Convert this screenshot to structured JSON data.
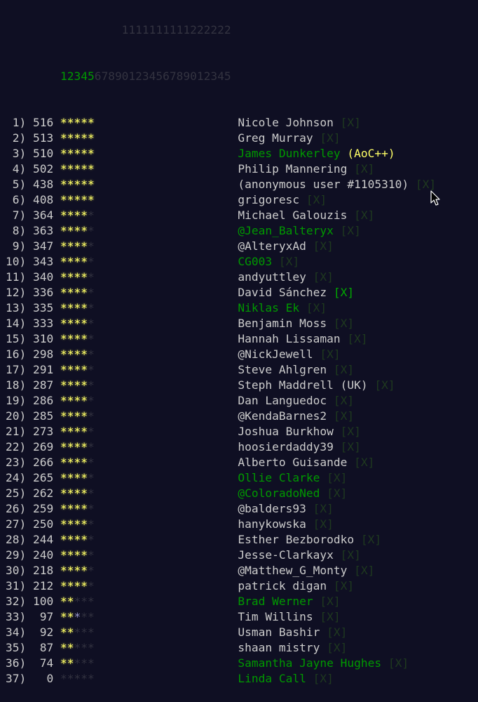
{
  "header": {
    "tens_row": "         1111111111222222",
    "units_row": "1234567890123456789012345",
    "days_completed_highlight": 5
  },
  "colors": {
    "background": "#0f0f23",
    "text": "#cccccc",
    "gold_star": "#ffff66",
    "silver_star": "#9999cc",
    "unearned_star": "#333340",
    "link_green": "#009900",
    "remove_dim": "#1f3a1f",
    "remove_hover": "#00aa00"
  },
  "remove_label": "[X]",
  "aocpp_label": "(AoC++)",
  "rows": [
    {
      "rank": "1)",
      "score": "516",
      "stars": "GGGGG",
      "name": "Nicole Johnson",
      "link": false
    },
    {
      "rank": "2)",
      "score": "513",
      "stars": "GGGGG",
      "name": "Greg Murray",
      "link": false
    },
    {
      "rank": "3)",
      "score": "510",
      "stars": "GGGGG",
      "name": "James Dunkerley",
      "link": true,
      "aocpp": true,
      "no_remove": true
    },
    {
      "rank": "4)",
      "score": "502",
      "stars": "GGGGG",
      "name": "Philip Mannering",
      "link": false
    },
    {
      "rank": "5)",
      "score": "438",
      "stars": "GGGGG",
      "name": "(anonymous user #1105310)",
      "link": false
    },
    {
      "rank": "6)",
      "score": "408",
      "stars": "GGGGG",
      "name": "grigoresc",
      "link": false
    },
    {
      "rank": "7)",
      "score": "364",
      "stars": "GGGG.",
      "name": "Michael Galouzis",
      "link": false
    },
    {
      "rank": "8)",
      "score": "363",
      "stars": "GGGG.",
      "name": "@Jean_Balteryx",
      "link": true
    },
    {
      "rank": "9)",
      "score": "347",
      "stars": "GGGG.",
      "name": "@AlteryxAd",
      "link": false
    },
    {
      "rank": "10)",
      "score": "343",
      "stars": "GGGG.",
      "name": "CG003",
      "link": true
    },
    {
      "rank": "11)",
      "score": "340",
      "stars": "GGGG.",
      "name": "andyuttley",
      "link": false
    },
    {
      "rank": "12)",
      "score": "336",
      "stars": "GGGG.",
      "name": "David Sánchez",
      "link": false,
      "remove_hover": true
    },
    {
      "rank": "13)",
      "score": "335",
      "stars": "GGGG.",
      "name": "Niklas Ek",
      "link": true
    },
    {
      "rank": "14)",
      "score": "333",
      "stars": "GGGG.",
      "name": "Benjamin Moss",
      "link": false
    },
    {
      "rank": "15)",
      "score": "310",
      "stars": "GGGG.",
      "name": "Hannah Lissaman",
      "link": false
    },
    {
      "rank": "16)",
      "score": "298",
      "stars": "GGGG.",
      "name": "@NickJewell",
      "link": false
    },
    {
      "rank": "17)",
      "score": "291",
      "stars": "GGGG.",
      "name": "Steve Ahlgren",
      "link": false
    },
    {
      "rank": "18)",
      "score": "287",
      "stars": "GGGG.",
      "name": "Steph Maddrell (UK)",
      "link": false
    },
    {
      "rank": "19)",
      "score": "286",
      "stars": "GGGG.",
      "name": "Dan Languedoc",
      "link": false
    },
    {
      "rank": "20)",
      "score": "285",
      "stars": "GGGG.",
      "name": "@KendaBarnes2",
      "link": false
    },
    {
      "rank": "21)",
      "score": "273",
      "stars": "GGGG.",
      "name": "Joshua Burkhow",
      "link": false
    },
    {
      "rank": "22)",
      "score": "269",
      "stars": "GGGG.",
      "name": "hoosierdaddy39",
      "link": false
    },
    {
      "rank": "23)",
      "score": "266",
      "stars": "GGGG.",
      "name": "Alberto Guisande",
      "link": false
    },
    {
      "rank": "24)",
      "score": "265",
      "stars": "GGGG.",
      "name": "Ollie Clarke",
      "link": true
    },
    {
      "rank": "25)",
      "score": "262",
      "stars": "GGGG.",
      "name": "@ColoradoNed",
      "link": true
    },
    {
      "rank": "26)",
      "score": "259",
      "stars": "GGGG.",
      "name": "@balders93",
      "link": false
    },
    {
      "rank": "27)",
      "score": "250",
      "stars": "GGGG.",
      "name": "hanykowska",
      "link": false
    },
    {
      "rank": "28)",
      "score": "244",
      "stars": "GGGG.",
      "name": "Esther Bezborodko",
      "link": false
    },
    {
      "rank": "29)",
      "score": "240",
      "stars": "GGGG.",
      "name": "Jesse-Clarkayx",
      "link": false
    },
    {
      "rank": "30)",
      "score": "218",
      "stars": "GGGG.",
      "name": "@Matthew_G_Monty",
      "link": false
    },
    {
      "rank": "31)",
      "score": "212",
      "stars": "GGGG.",
      "name": "patrick digan",
      "link": false
    },
    {
      "rank": "32)",
      "score": "100",
      "stars": "GG...",
      "name": "Brad Werner",
      "link": true
    },
    {
      "rank": "33)",
      "score": "97",
      "stars": "GGS..",
      "name": "Tim Willins",
      "link": false
    },
    {
      "rank": "34)",
      "score": "92",
      "stars": "GG...",
      "name": "Usman Bashir",
      "link": false
    },
    {
      "rank": "35)",
      "score": "87",
      "stars": "GG...",
      "name": "shaan mistry",
      "link": false
    },
    {
      "rank": "36)",
      "score": "74",
      "stars": "GG...",
      "name": "Samantha Jayne Hughes",
      "link": true
    },
    {
      "rank": "37)",
      "score": "0",
      "stars": ".....",
      "name": "Linda Call",
      "link": true
    }
  ]
}
